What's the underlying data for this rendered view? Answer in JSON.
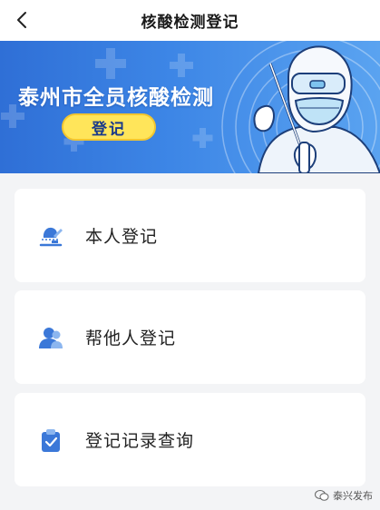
{
  "nav": {
    "title": "核酸检测登记",
    "back_icon": "chevron-left-icon"
  },
  "banner": {
    "headline": "泰州市全员核酸检测",
    "button_label": "登记",
    "colors": {
      "bg_start": "#2f6fd6",
      "bg_end": "#5aa3f0",
      "button": "#ffe55a"
    }
  },
  "menu": [
    {
      "label": "本人登记",
      "icon": "self-register-icon"
    },
    {
      "label": "帮他人登记",
      "icon": "users-icon"
    },
    {
      "label": "登记记录查询",
      "icon": "clipboard-check-icon"
    }
  ],
  "watermark": {
    "text": "泰兴发布"
  }
}
